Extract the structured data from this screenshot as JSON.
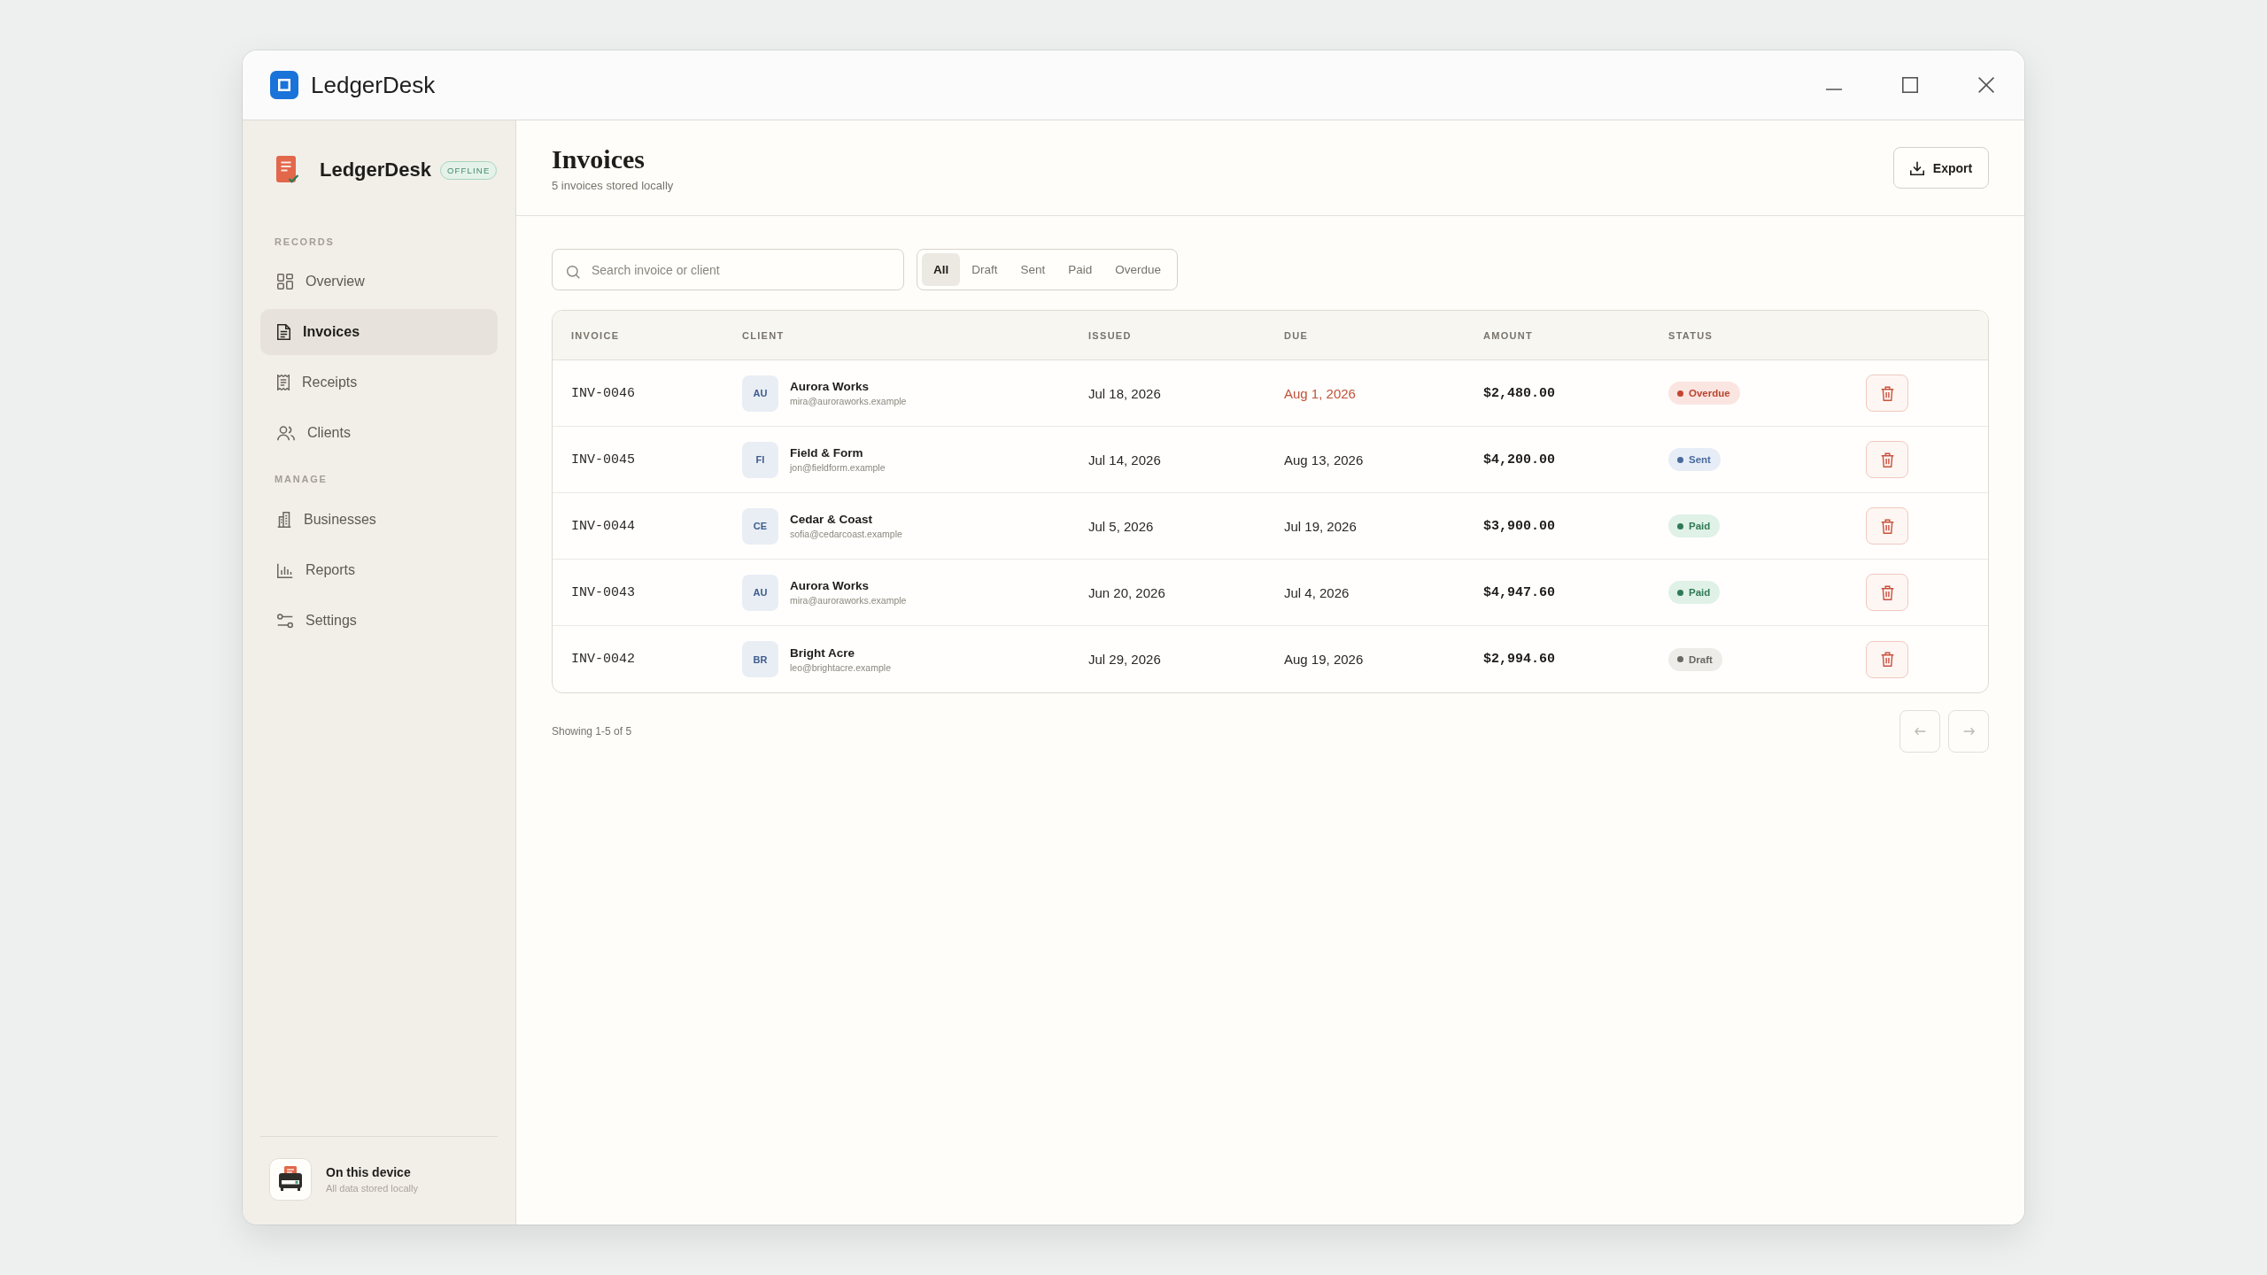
{
  "window": {
    "title": "LedgerDesk"
  },
  "sidebar": {
    "brand": "LedgerDesk",
    "badge": "OFFLINE",
    "sections": [
      {
        "label": "RECORDS",
        "items": [
          {
            "label": "Overview",
            "selected": false
          },
          {
            "label": "Invoices",
            "selected": true
          },
          {
            "label": "Receipts",
            "selected": false
          },
          {
            "label": "Clients",
            "selected": false
          }
        ]
      },
      {
        "label": "MANAGE",
        "items": [
          {
            "label": "Businesses",
            "selected": false
          },
          {
            "label": "Reports",
            "selected": false
          },
          {
            "label": "Settings",
            "selected": false
          }
        ]
      }
    ],
    "footer": {
      "title": "On this device",
      "subtitle": "All data stored locally"
    }
  },
  "header": {
    "title": "Invoices",
    "subtitle": "5 invoices stored locally",
    "export_button": "Export"
  },
  "toolbar": {
    "search": {
      "placeholder": "Search invoice or client"
    },
    "filters": [
      {
        "label": "All",
        "selected": true
      },
      {
        "label": "Draft",
        "selected": false
      },
      {
        "label": "Sent",
        "selected": false
      },
      {
        "label": "Paid",
        "selected": false
      },
      {
        "label": "Overdue",
        "selected": false
      }
    ]
  },
  "table": {
    "columns": [
      "INVOICE",
      "CLIENT",
      "ISSUED",
      "DUE",
      "AMOUNT",
      "STATUS"
    ],
    "rows": [
      {
        "invoice": "INV-0046",
        "client": {
          "initials": "AU",
          "name": "Aurora Works",
          "email": "mira@auroraworks.example"
        },
        "issued": "Jul 18, 2026",
        "due": "Aug 1, 2026",
        "amount": "$2,480.00",
        "status": {
          "kind": "overdue",
          "label": "Overdue"
        }
      },
      {
        "invoice": "INV-0045",
        "client": {
          "initials": "FI",
          "name": "Field & Form",
          "email": "jon@fieldform.example"
        },
        "issued": "Jul 14, 2026",
        "due": "Aug 13, 2026",
        "amount": "$4,200.00",
        "status": {
          "kind": "sent",
          "label": "Sent"
        }
      },
      {
        "invoice": "INV-0044",
        "client": {
          "initials": "CE",
          "name": "Cedar & Coast",
          "email": "sofia@cedarcoast.example"
        },
        "issued": "Jul 5, 2026",
        "due": "Jul 19, 2026",
        "amount": "$3,900.00",
        "status": {
          "kind": "paid",
          "label": "Paid"
        }
      },
      {
        "invoice": "INV-0043",
        "client": {
          "initials": "AU",
          "name": "Aurora Works",
          "email": "mira@auroraworks.example"
        },
        "issued": "Jun 20, 2026",
        "due": "Jul 4, 2026",
        "amount": "$4,947.60",
        "status": {
          "kind": "paid",
          "label": "Paid"
        }
      },
      {
        "invoice": "INV-0042",
        "client": {
          "initials": "BR",
          "name": "Bright Acre",
          "email": "leo@brightacre.example"
        },
        "issued": "Jul 29, 2026",
        "due": "Aug 19, 2026",
        "amount": "$2,994.60",
        "status": {
          "kind": "draft",
          "label": "Draft"
        }
      }
    ]
  },
  "pagination": {
    "summary": "Showing 1-5 of 5",
    "prev": {
      "disabled": true
    },
    "next": {
      "disabled": true
    }
  }
}
